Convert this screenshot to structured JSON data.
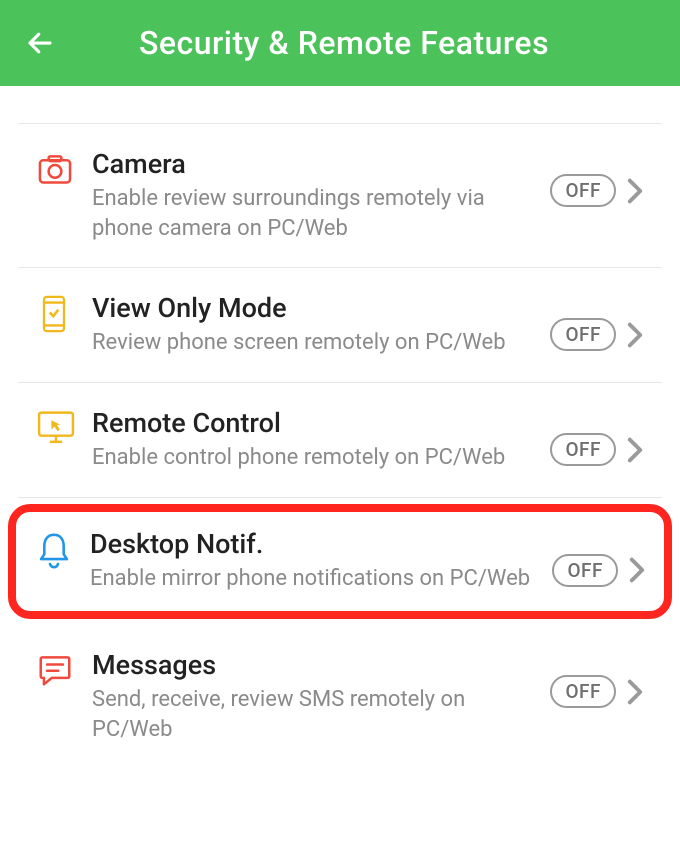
{
  "header": {
    "title": "Security & Remote Features"
  },
  "items": [
    {
      "title": "Camera",
      "desc": "Enable review surroundings remotely via phone camera on PC/Web",
      "status": "OFF"
    },
    {
      "title": "View Only Mode",
      "desc": "Review phone screen remotely on PC/Web",
      "status": "OFF"
    },
    {
      "title": "Remote Control",
      "desc": "Enable control phone remotely on PC/Web",
      "status": "OFF"
    },
    {
      "title": "Desktop Notif.",
      "desc": "Enable mirror phone notifications on PC/Web",
      "status": "OFF"
    },
    {
      "title": "Messages",
      "desc": "Send, receive, review SMS remotely on PC/Web",
      "status": "OFF"
    }
  ]
}
